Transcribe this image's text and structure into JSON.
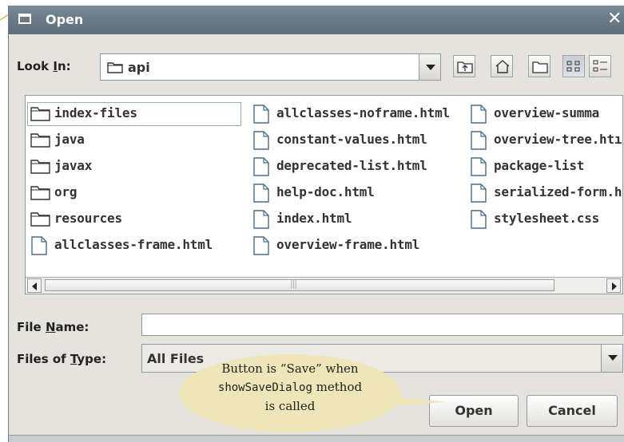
{
  "window": {
    "title": "Open"
  },
  "look_in": {
    "label_pre": "Look ",
    "label_accel": "I",
    "label_post": "n:",
    "value": "api"
  },
  "toolbar": {
    "icons": [
      "up-folder-icon",
      "home-icon",
      "new-folder-icon",
      "list-view-icon",
      "details-view-icon"
    ],
    "active": "list-view-icon"
  },
  "files": {
    "col1": [
      {
        "name": "index-files",
        "type": "folder",
        "selected": true
      },
      {
        "name": "java",
        "type": "folder"
      },
      {
        "name": "javax",
        "type": "folder"
      },
      {
        "name": "org",
        "type": "folder"
      },
      {
        "name": "resources",
        "type": "folder"
      },
      {
        "name": "allclasses-frame.html",
        "type": "file"
      }
    ],
    "col2": [
      {
        "name": "allclasses-noframe.html",
        "type": "file"
      },
      {
        "name": "constant-values.html",
        "type": "file"
      },
      {
        "name": "deprecated-list.html",
        "type": "file"
      },
      {
        "name": "help-doc.html",
        "type": "file"
      },
      {
        "name": "index.html",
        "type": "file"
      },
      {
        "name": "overview-frame.html",
        "type": "file"
      }
    ],
    "col3": [
      {
        "name": "overview-summa",
        "type": "file"
      },
      {
        "name": "overview-tree.htı",
        "type": "file"
      },
      {
        "name": "package-list",
        "type": "file"
      },
      {
        "name": "serialized-form.h",
        "type": "file"
      },
      {
        "name": "stylesheet.css",
        "type": "file"
      }
    ]
  },
  "file_name": {
    "label_pre": "File ",
    "label_accel": "N",
    "label_post": "ame:",
    "value": ""
  },
  "files_of_type": {
    "label_pre": "Files of ",
    "label_accel": "T",
    "label_post": "ype:",
    "value": "All Files"
  },
  "buttons": {
    "open": "Open",
    "cancel": "Cancel"
  },
  "callout": {
    "line1": "Button is “Save” when",
    "line2_code": "showSaveDialog",
    "line2_rest": " method",
    "line3": "is called"
  },
  "colors": {
    "titlebar": "#6a7b86",
    "dialog_bg": "#e5e3dd",
    "callout": "#eee6b8"
  }
}
